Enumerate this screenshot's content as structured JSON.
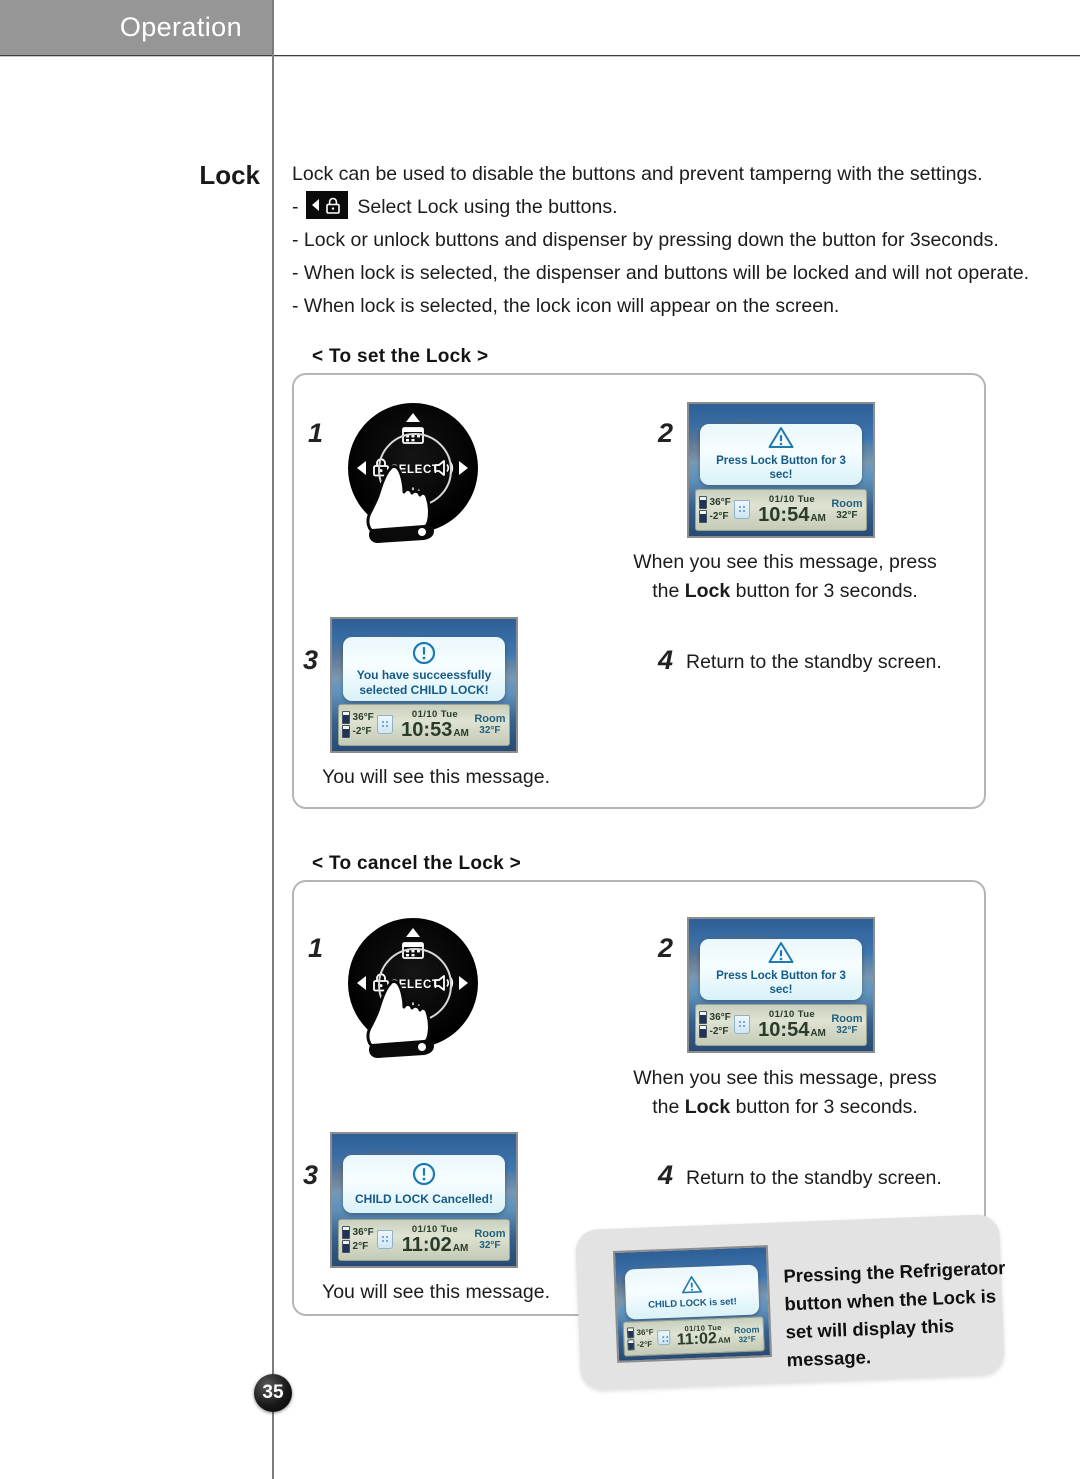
{
  "header": {
    "title": "Operation"
  },
  "page_number": "35",
  "intro": {
    "label": "Lock",
    "lines": [
      "Lock can be used to disable the buttons and prevent tamperng with the settings.",
      "Select Lock using the buttons.",
      "- Lock or unlock buttons and dispenser by pressing down the button for 3seconds.",
      "- When lock is selected, the dispenser and buttons will be locked and will not operate.",
      "- When lock is selected, the lock icon will appear on the screen."
    ],
    "bullet_dash": "-",
    "icon_names": [
      "left-arrow-icon",
      "padlock-icon"
    ]
  },
  "dial": {
    "select_label": "SELECT",
    "buttons": [
      "calendar-icon",
      "lock-icon",
      "speaker-icon",
      "light-icon"
    ]
  },
  "sections": [
    {
      "title": "< To set the Lock >",
      "steps": {
        "one": "1",
        "two": "2",
        "three": "3",
        "four": "4"
      },
      "step2_caption_line1": "When you see this message, press",
      "step2_caption_line2_pre": "the ",
      "step2_caption_line2_bold": "Lock",
      "step2_caption_line2_post": " button for 3 seconds.",
      "step4_caption": "Return to the standby screen.",
      "step3_caption": "You will see this message.",
      "screen2": {
        "message_lines": [
          "Press Lock Button for 3 sec!"
        ],
        "icon": "warning-triangle-icon",
        "status": {
          "fridge_temp": "36°F",
          "freezer_temp": "-2°F",
          "date": "01/10  Tue",
          "time": "10:54",
          "meridiem": "AM",
          "room_label": "Room",
          "room_temp": "32°F"
        }
      },
      "screen3": {
        "message_lines": [
          "You have succeessfully",
          "selected CHILD LOCK!"
        ],
        "icon": "exclamation-circle-icon",
        "status": {
          "fridge_temp": "36°F",
          "freezer_temp": "-2°F",
          "date": "01/10  Tue",
          "time": "10:53",
          "meridiem": "AM",
          "room_label": "Room",
          "room_temp": "32°F"
        }
      }
    },
    {
      "title": "< To cancel the Lock >",
      "steps": {
        "one": "1",
        "two": "2",
        "three": "3",
        "four": "4"
      },
      "step2_caption_line1": "When you see this message, press",
      "step2_caption_line2_pre": "the ",
      "step2_caption_line2_bold": "Lock",
      "step2_caption_line2_post": " button for 3 seconds.",
      "step4_caption": "Return to the standby screen.",
      "step3_caption": "You will see this message.",
      "screen2": {
        "message_lines": [
          "Press Lock Button for 3 sec!"
        ],
        "icon": "warning-triangle-icon",
        "status": {
          "fridge_temp": "36°F",
          "freezer_temp": "-2°F",
          "date": "01/10  Tue",
          "time": "10:54",
          "meridiem": "AM",
          "room_label": "Room",
          "room_temp": "32°F"
        }
      },
      "screen3": {
        "message_lines": [
          "CHILD LOCK Cancelled!"
        ],
        "icon": "exclamation-circle-icon",
        "status": {
          "fridge_temp": "36°F",
          "freezer_temp": "2°F",
          "date": "01/10  Tue",
          "time": "11:02",
          "meridiem": "AM",
          "room_label": "Room",
          "room_temp": "32°F"
        }
      }
    }
  ],
  "callout": {
    "text_lines": [
      "Pressing the Refrigerator",
      "button when the Lock is",
      "set will display this",
      "message."
    ],
    "screen": {
      "message_lines": [
        "CHILD LOCK is set!"
      ],
      "icon": "warning-triangle-icon",
      "status": {
        "fridge_temp": "36°F",
        "freezer_temp": "-2°F",
        "date": "01/10  Tue",
        "time": "11:02",
        "meridiem": "AM",
        "room_label": "Room",
        "room_temp": "32°F"
      }
    }
  },
  "colors": {
    "header_bg": "#969696",
    "lcd_text": "#165a86",
    "panel_border": "#b5b5b5",
    "callout_bg": "#e3e3e3"
  }
}
